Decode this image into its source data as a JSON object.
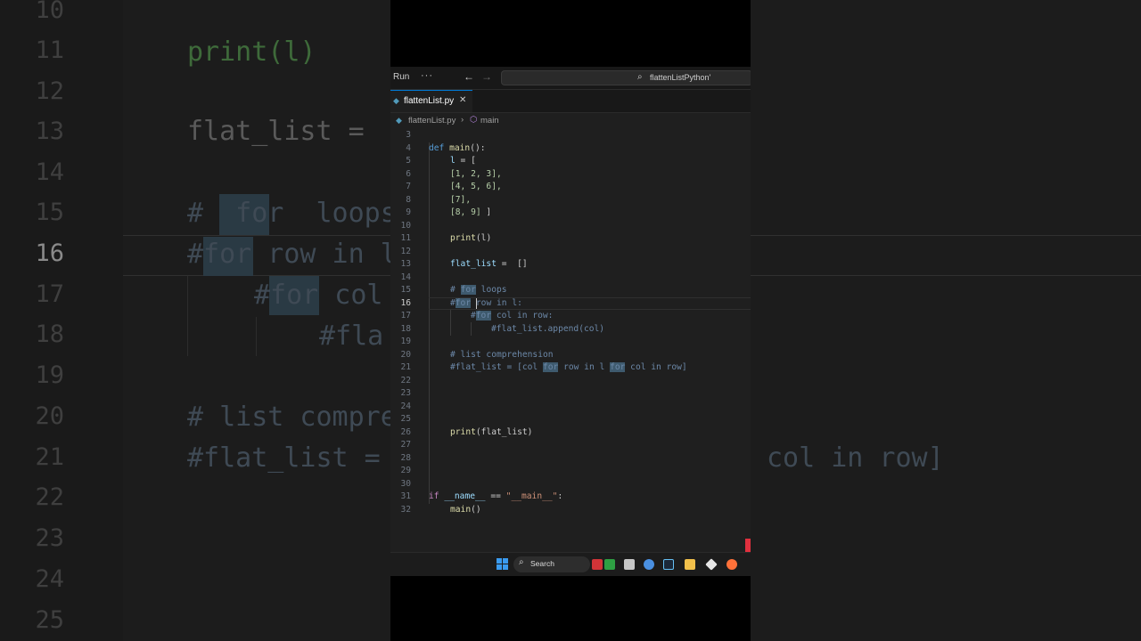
{
  "background_zoom": {
    "lines": [
      {
        "n": "10",
        "code": ""
      },
      {
        "n": "11",
        "code": "print(l)"
      },
      {
        "n": "12",
        "code": ""
      },
      {
        "n": "13",
        "code": "flat_list ="
      },
      {
        "n": "14",
        "code": ""
      },
      {
        "n": "15",
        "code": "#  for  loops"
      },
      {
        "n": "16",
        "code": "#for row in l"
      },
      {
        "n": "17",
        "code": "#for col"
      },
      {
        "n": "18",
        "code": "#fla"
      },
      {
        "n": "19",
        "code": ""
      },
      {
        "n": "20",
        "code": "# list compre"
      },
      {
        "n": "21",
        "code": "#flat_list ="
      },
      {
        "n": "22",
        "code": ""
      },
      {
        "n": "23",
        "code": ""
      },
      {
        "n": "24",
        "code": ""
      },
      {
        "n": "25",
        "code": ""
      }
    ],
    "right_fragment": "col in row]"
  },
  "titlebar": {
    "run_label": "Run",
    "more_icon": "ellipsis-icon",
    "back_icon": "arrow-left-icon",
    "forward_icon": "arrow-right-icon",
    "search_text": "flattenListPython'"
  },
  "tab": {
    "label": "flattenList.py",
    "icon": "python-file-icon",
    "close_icon": "close-icon"
  },
  "breadcrumb": {
    "file": "flattenList.py",
    "separator": "›",
    "symbol": "main"
  },
  "editor": {
    "active_line": "16",
    "lines": [
      {
        "n": "3"
      },
      {
        "n": "4"
      },
      {
        "n": "5"
      },
      {
        "n": "6"
      },
      {
        "n": "7"
      },
      {
        "n": "8"
      },
      {
        "n": "9"
      },
      {
        "n": "10"
      },
      {
        "n": "11"
      },
      {
        "n": "12"
      },
      {
        "n": "13"
      },
      {
        "n": "14"
      },
      {
        "n": "15"
      },
      {
        "n": "16"
      },
      {
        "n": "17"
      },
      {
        "n": "18"
      },
      {
        "n": "19"
      },
      {
        "n": "20"
      },
      {
        "n": "21"
      },
      {
        "n": "22"
      },
      {
        "n": "23"
      },
      {
        "n": "24"
      },
      {
        "n": "25"
      },
      {
        "n": "26"
      },
      {
        "n": "27"
      },
      {
        "n": "28"
      },
      {
        "n": "29"
      },
      {
        "n": "30"
      },
      {
        "n": "31"
      },
      {
        "n": "32"
      }
    ],
    "tokens": {
      "def": "def",
      "main": "main",
      "parens_colon": "():",
      "l": "l",
      "eq_open": " = [",
      "r6": "[1, 2, 3],",
      "r7": "[4, 5, 6],",
      "r8": "[7],",
      "r9a": "[8, 9]",
      "r9b": " ]",
      "print": "print",
      "print_l": "(l)",
      "flat_list": "flat_list",
      "eq_empty": " =  []",
      "c15a": "# ",
      "c15for": "for",
      "c15b": " loops",
      "c16a": "#",
      "c16for": "for",
      "c16b": " r",
      "c16c": "ow in l:",
      "c17a": "#",
      "c17for": "for",
      "c17b": " col in row:",
      "c18": "#flat_list.append(col)",
      "c20": "# list comprehension",
      "c21a": "#flat_list = [col ",
      "c21for1": "for",
      "c21b": " row in l ",
      "c21for2": "for",
      "c21c": " col in row]",
      "print26": "print",
      "print26_args": "(flat_list)",
      "if": "if",
      "name": "__name__",
      "eqeq": " == ",
      "main_str": "\"__main__\"",
      "colon": ":",
      "main_call": "main",
      "main_call_parens": "()"
    }
  },
  "taskbar": {
    "start_icon": "windows-logo-icon",
    "search_placeholder": "Search",
    "apps": [
      "app-icon-red",
      "app-icon-green",
      "app-icon-gray",
      "copilot-icon",
      "steam-icon",
      "folder-icon",
      "git-icon",
      "firefox-icon"
    ]
  },
  "colors": {
    "editor_bg": "#1f1f1f",
    "keyword": "#569cd6",
    "function": "#dcdcaa",
    "number": "#b5cea8",
    "string": "#ce9178",
    "comment": "#6a9955",
    "accent": "#0078d4"
  }
}
